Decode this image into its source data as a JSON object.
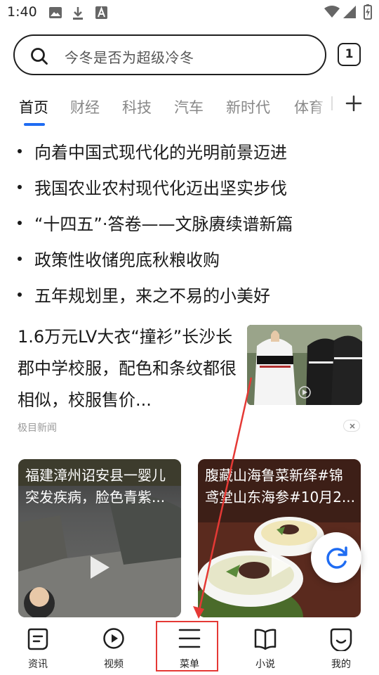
{
  "status_bar": {
    "time": "1:40",
    "icons": [
      "image-icon",
      "download-icon",
      "font-a-icon",
      "wifi-icon",
      "signal-icon",
      "battery-charging-icon"
    ]
  },
  "search": {
    "placeholder": "今冬是否为超级冷冬",
    "tab_count": "1"
  },
  "channels": {
    "tabs": [
      "首页",
      "财经",
      "科技",
      "汽车",
      "新时代",
      "体育"
    ],
    "active_index": 0,
    "accent_color": "#1f6cf2",
    "add_icon": "plus-icon"
  },
  "headlines": [
    "向着中国式现代化的光明前景迈进",
    "我国农业农村现代化迈出坚实步伐",
    "“十四五”·答卷——文脉赓续谱新篇",
    "政策性收储兜底秋粮收购",
    "五年规划里，来之不易的小美好"
  ],
  "news_item": {
    "title": "1.6万元LV大衣“撞衫”长沙长郡中学校服，配色和条纹都很相似，校服售价...",
    "source": "极目新闻",
    "thumbnail_icon": "school-uniform-photo",
    "dismiss_icon": "close-icon"
  },
  "video_cards": [
    {
      "title": "福建漳州诏安县一婴儿突发疾病，脸色青紫...",
      "icon": "play-icon"
    },
    {
      "title": "腹藏山海鲁菜新绎#锦鸢堂山东海参#10月2...",
      "icon": "play-icon"
    }
  ],
  "refresh_icon": "refresh-icon",
  "bottom_nav": [
    {
      "label": "资讯",
      "icon": "news-icon"
    },
    {
      "label": "视频",
      "icon": "video-play-icon"
    },
    {
      "label": "菜单",
      "icon": "menu-icon"
    },
    {
      "label": "小说",
      "icon": "book-icon"
    },
    {
      "label": "我的",
      "icon": "smile-icon"
    }
  ],
  "annotation": {
    "color": "#e53935",
    "target": "菜单"
  }
}
